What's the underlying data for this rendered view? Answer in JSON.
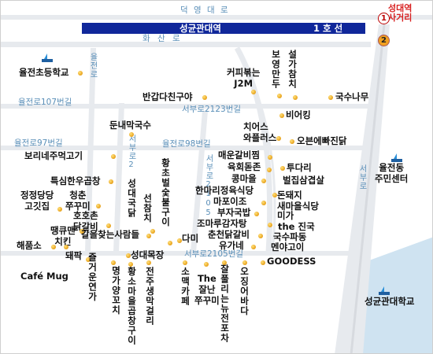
{
  "top_road": "덕 영 대 로",
  "station": {
    "name": "성균관대역",
    "line": "1 호 선",
    "exit_title": "성대역\n사거리",
    "exit1": "1",
    "exit2": "2"
  },
  "hwasanro": "화 산 로",
  "road_names": {
    "yuljeonro107": "율전로107번길",
    "yuljeonro97": "율전로97번길",
    "yuljeonro98": "율전로98번길",
    "seobu2123": "서부로2123번길",
    "seobu2105": "서부로2105번길",
    "yuljeonro_v": "율전로",
    "seobu2_v1": "서부로2",
    "seobu2_v2": "서부로2105",
    "seobu_v3": "서부로"
  },
  "places": {
    "yuljeon_school": "율전초등학교",
    "coffee_j2m": "커피볶는\nJ2M",
    "bogyeong": "보영만두",
    "seolgachi": "설가참치",
    "bangap": "반갑다친구야",
    "guksunamu": "국수나무",
    "bihyang": "비어킹",
    "dunnae": "둔내막국수",
    "chiers": "치어스\n와플러스",
    "oven": "오븐에빠진닭",
    "bori": "보리네주먹고기",
    "maeun": "매운갈비찜",
    "yukhoe": "육회돋존",
    "kongma": "콩마을",
    "teudari": "투다리",
    "beoljip": "벌집삼겹살",
    "yuljeon_center": "율전동\n주민센터",
    "teukseon": "특심한우곱창",
    "jeongjeong": "정정당당\n고깃집",
    "cheongchun": "청춘\n쭈꾸미",
    "hohochon": "호호촌\n닭갈비",
    "seongdae_gukdal": "성대국닭",
    "seoncham": "선참치",
    "hwangcho": "황초벌숯불구이",
    "hanmari": "한마리정육식당",
    "mapo": "마포이조",
    "bujaguk": "부자국밥",
    "dondwaeji": "돈돼지\n새마을식당",
    "miga": "미가",
    "jomaru": "조마루감자탕",
    "chuncheon": "춘천닭갈비",
    "yugane": "유가네",
    "thejingu": "the 진국",
    "guksupadong": "국수파동",
    "mengo": "멘야고이",
    "ddangkkeut": "땡큐맨\n치킨",
    "galbi_sarang": "갈을찾는사람들",
    "haebo": "해품소",
    "dwaeji": "돼팍",
    "damini": "다미",
    "seongdae_mokjang": "성대목장",
    "goodess": "GOODESS",
    "cafe_mug": "Café Mug",
    "jeulgeo": "즐거운연가",
    "myeongga": "명가양꼬치",
    "hwangso": "황소마을곱창구이",
    "jeonju": "전주생막걸리",
    "somaek": "소맥카페",
    "the_jalnan": "The\n잘난\n쭈꾸미",
    "jjalpeuri": "잘풀리는뉴전포차",
    "ojing": "오징어바다",
    "skku": "성균관대학교"
  },
  "colors": {
    "banner": "#10279a",
    "exit_red": "#d82020",
    "road_label": "#5a8fb8",
    "water": "#cfe3f1",
    "dot": "#e8a11a"
  }
}
